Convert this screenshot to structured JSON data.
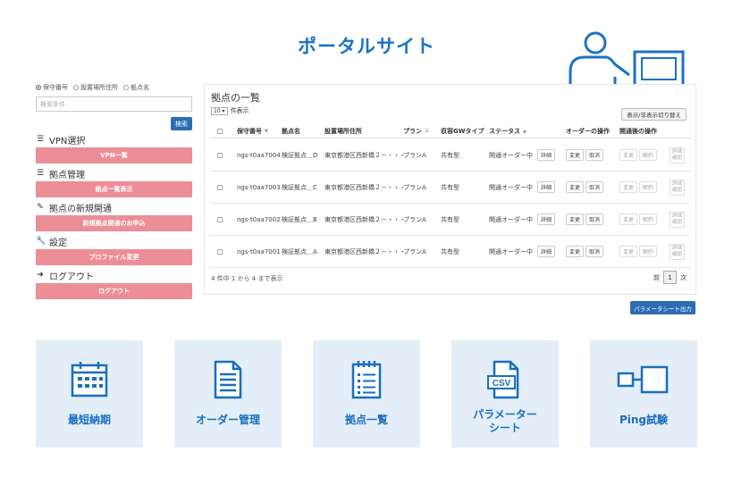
{
  "title": "ポータルサイト",
  "sidebar": {
    "radios": [
      "保守番号",
      "設置場所住所",
      "拠点名"
    ],
    "search_placeholder": "検索条件",
    "search_button": "検索",
    "sections": [
      {
        "icon": "list-icon",
        "label": "VPN選択",
        "button": "VPN一覧"
      },
      {
        "icon": "list-icon",
        "label": "拠点管理",
        "button": "拠点一覧表示"
      },
      {
        "icon": "edit-icon",
        "label": "拠点の新規開通",
        "button": "新規拠点開通のお申込"
      },
      {
        "icon": "wrench-icon",
        "label": "設定",
        "button": "プロファイル変更"
      },
      {
        "icon": "logout-icon",
        "label": "ログアウト",
        "button": "ログアウト"
      }
    ]
  },
  "table": {
    "title": "拠点の一覧",
    "per_page_value": "10",
    "per_page_suffix": "件表示",
    "toggle_button": "表示/非表示切り替え",
    "headers": [
      "保守番号",
      "拠点名",
      "設置場所住所",
      "プラン",
      "収容GWタイプ",
      "ステータス",
      "オーダーの操作",
      "開通後の操作"
    ],
    "rows": [
      {
        "id": "ngs-t0aa7004",
        "name": "検証拠点＿D",
        "address": "東京都港区西新橋２－・・・",
        "plan": "プランA",
        "gw": "共有型",
        "status": "開通オーダー中"
      },
      {
        "id": "ngs-t0aa7003",
        "name": "検証拠点＿C",
        "address": "東京都港区西新橋２－・・・",
        "plan": "プランA",
        "gw": "共有型",
        "status": "開通オーダー中"
      },
      {
        "id": "ngs-t0aa7002",
        "name": "検証拠点＿B",
        "address": "東京都港区西新橋２－・・・",
        "plan": "プランA",
        "gw": "共有型",
        "status": "開通オーダー中"
      },
      {
        "id": "ngs-t0aa7001",
        "name": "検証拠点＿A",
        "address": "東京都港区西新橋２－・・・",
        "plan": "プランA",
        "gw": "共有型",
        "status": "開通オーダー中"
      }
    ],
    "row_buttons": {
      "detail": "詳細",
      "change": "変更",
      "cancel": "取消",
      "change2": "変更",
      "cancel2": "解約",
      "detail_check_1": "詳細",
      "detail_check_2": "確認"
    },
    "footer_info": "4 件中 1 から 4 まで表示",
    "pager": {
      "prev": "前",
      "current": "1",
      "next": "次"
    }
  },
  "param_button": "パラメータシート出力",
  "tiles": [
    {
      "icon": "calendar-icon",
      "label": "最短納期"
    },
    {
      "icon": "document-icon",
      "label": "オーダー管理"
    },
    {
      "icon": "checklist-icon",
      "label": "拠点一覧"
    },
    {
      "icon": "csv-icon",
      "label": "パラメーター\nシート"
    },
    {
      "icon": "ping-icon",
      "label": "Ping試験"
    }
  ]
}
